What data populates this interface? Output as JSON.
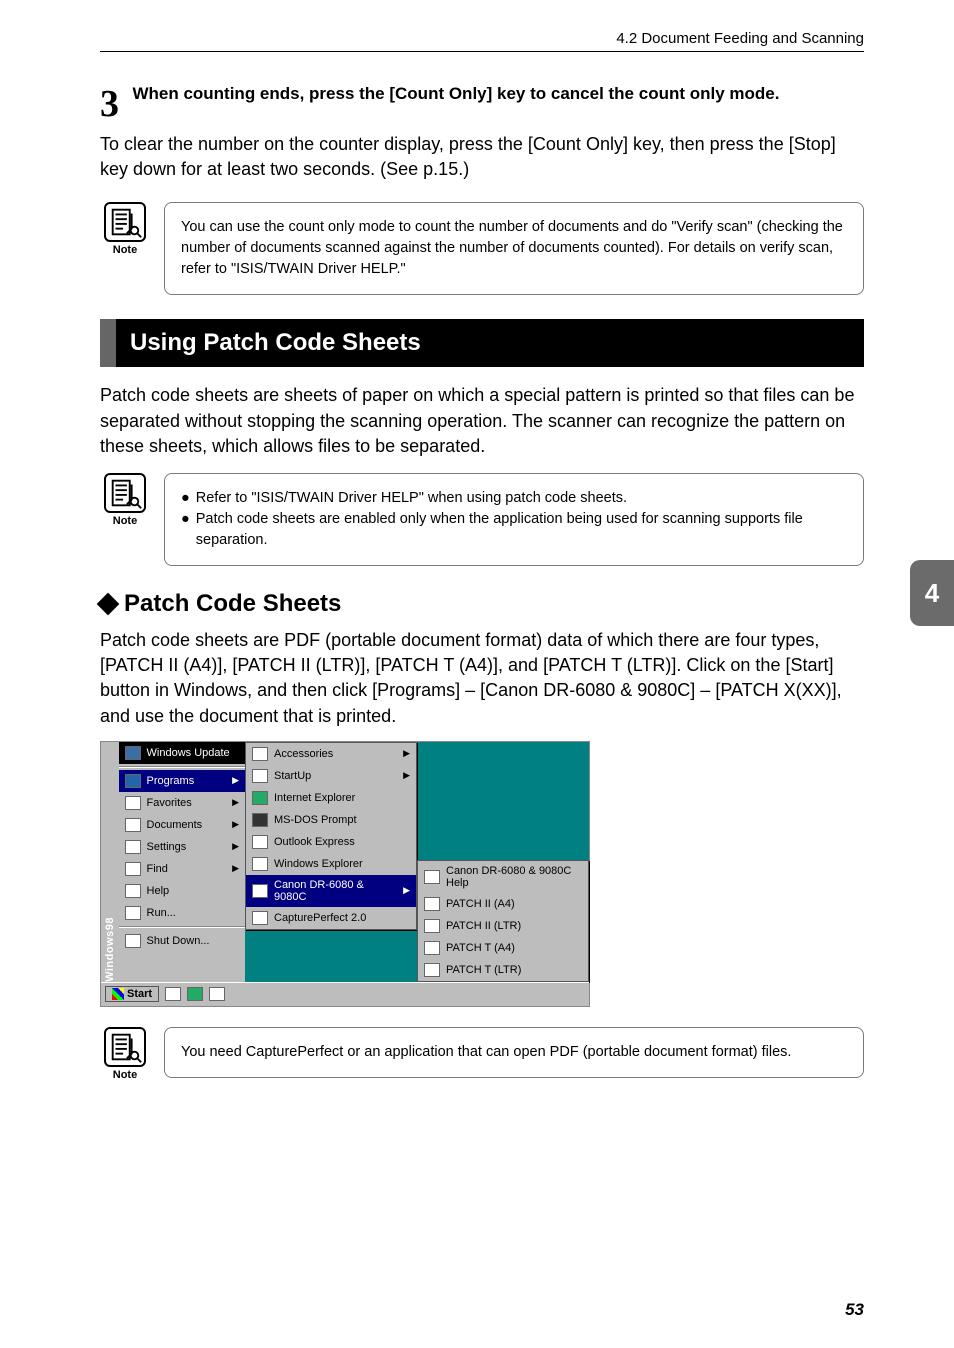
{
  "header": {
    "section_label": "4.2   Document Feeding and Scanning"
  },
  "step3": {
    "num": "3",
    "bold": "When counting ends, press the [Count Only] key to cancel the count only mode.",
    "desc": "To clear the number on the counter display, press the [Count Only] key, then press the [Stop] key down for at least two seconds. (See p.15.)"
  },
  "note1": {
    "label": "Note",
    "text": "You can use the count only mode to count the number of documents and do \"Verify scan\" (checking the number of documents scanned against the number of documents counted). For details on verify scan, refer to \"ISIS/TWAIN Driver HELP.\""
  },
  "section_bar": "Using Patch Code Sheets",
  "para1": "Patch code sheets are sheets of paper on which a special pattern is printed so that files can be separated without stopping the scanning operation. The scanner can recognize the pattern on these sheets, which allows files to be separated.",
  "note2": {
    "label": "Note",
    "bullets": [
      "Refer to \"ISIS/TWAIN Driver HELP\" when using patch code sheets.",
      "Patch code sheets are enabled only when the application being used for scanning supports file separation."
    ]
  },
  "subheading": "Patch Code Sheets",
  "para2": "Patch code sheets are PDF (portable document format) data of which there are four types, [PATCH II (A4)], [PATCH II (LTR)], [PATCH T (A4)], and [PATCH T (LTR)]. Click on the [Start] button in Windows, and then click [Programs] – [Canon DR-6080 & 9080C] – [PATCH X(XX)], and use the document that is printed.",
  "screenshot": {
    "sidebar_text": "Windows98",
    "top_item": "Windows Update",
    "start_menu": [
      "Programs",
      "Favorites",
      "Documents",
      "Settings",
      "Find",
      "Help",
      "Run..."
    ],
    "shutdown": "Shut Down...",
    "programs_sub": [
      "Accessories",
      "StartUp",
      "Internet Explorer",
      "MS-DOS Prompt",
      "Outlook Express",
      "Windows Explorer",
      "Canon DR-6080 & 9080C",
      "CapturePerfect 2.0"
    ],
    "canon_sub": [
      "Canon DR-6080 & 9080C Help",
      "PATCH II (A4)",
      "PATCH II (LTR)",
      "PATCH T (A4)",
      "PATCH T (LTR)"
    ],
    "taskbar_start": "Start"
  },
  "note3": {
    "label": "Note",
    "text": "You need CapturePerfect or an application that can open PDF (portable document format) files."
  },
  "side_tab": "4",
  "page_number": "53"
}
